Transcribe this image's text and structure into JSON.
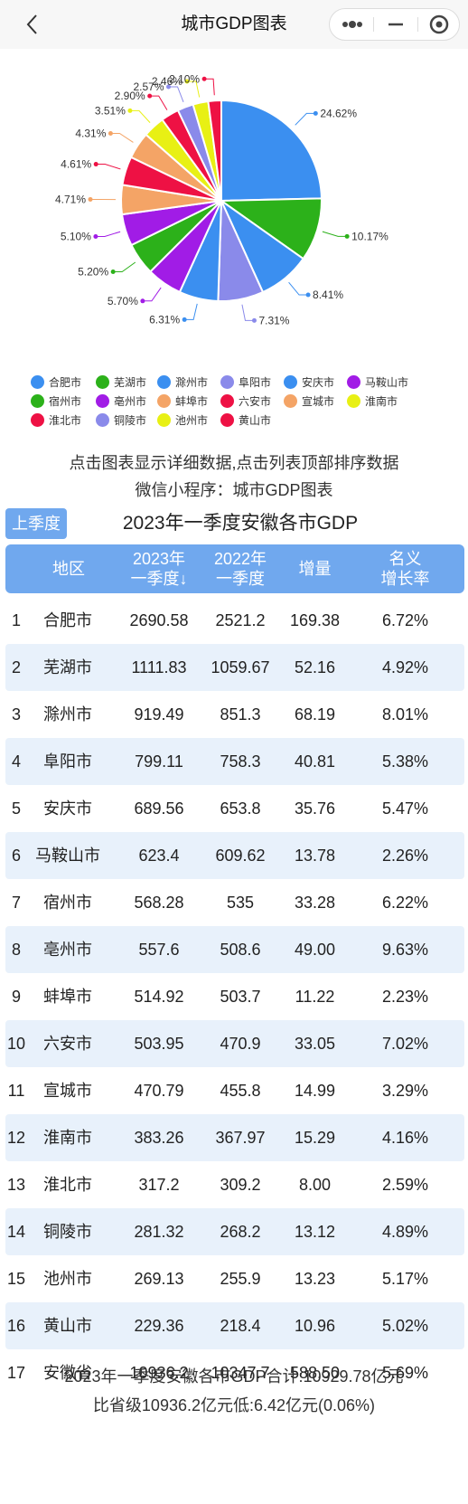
{
  "nav": {
    "title": "城市GDP图表",
    "back_icon": "chevron-left-icon",
    "more_icon": "more-dots-icon",
    "minimize_icon": "minimize-icon",
    "close_icon": "target-circle-icon"
  },
  "chart_data": {
    "type": "pie",
    "slices": [
      {
        "name": "合肥市",
        "value": 24.62,
        "label": "24.62%",
        "color": "#3b8ff0"
      },
      {
        "name": "芜湖市",
        "value": 10.17,
        "label": "10.17%",
        "color": "#2cb11a"
      },
      {
        "name": "滁州市",
        "value": 8.41,
        "label": "8.41%",
        "color": "#3b8ff0"
      },
      {
        "name": "阜阳市",
        "value": 7.31,
        "label": "7.31%",
        "color": "#8a8aea"
      },
      {
        "name": "安庆市",
        "value": 6.31,
        "label": "6.31%",
        "color": "#3b8ff0"
      },
      {
        "name": "马鞍山市",
        "value": 5.7,
        "label": "5.70%",
        "color": "#a11ce6"
      },
      {
        "name": "宿州市",
        "value": 5.2,
        "label": "5.20%",
        "color": "#2cb11a"
      },
      {
        "name": "亳州市",
        "value": 5.1,
        "label": "5.10%",
        "color": "#a11ce6"
      },
      {
        "name": "蚌埠市",
        "value": 4.71,
        "label": "4.71%",
        "color": "#f4a466"
      },
      {
        "name": "六安市",
        "value": 4.61,
        "label": "4.61%",
        "color": "#ee1144"
      },
      {
        "name": "宣城市",
        "value": 4.31,
        "label": "4.31%",
        "color": "#f4a466"
      },
      {
        "name": "淮南市",
        "value": 3.51,
        "label": "3.51%",
        "color": "#e8f014"
      },
      {
        "name": "淮北市",
        "value": 2.9,
        "label": "2.90%",
        "color": "#ee1144"
      },
      {
        "name": "铜陵市",
        "value": 2.57,
        "label": "2.57%",
        "color": "#8a8aea"
      },
      {
        "name": "池州市",
        "value": 2.46,
        "label": "2.46%",
        "color": "#e8f014"
      },
      {
        "name": "黄山市",
        "value": 2.1,
        "label": "2.10%",
        "color": "#ee1144"
      }
    ]
  },
  "hint_line1": "点击图表显示详细数据,点击列表顶部排序数据",
  "hint_line2": "微信小程序：城市GDP图表",
  "season_button": "上季度",
  "table_title": "2023年一季度安徽各市GDP",
  "headers": {
    "region": "地区",
    "y2023": "2023年\n一季度↓",
    "y2022": "2022年\n一季度",
    "increase": "增量",
    "growth": "名义\n增长率"
  },
  "rows": [
    {
      "rank": "1",
      "region": "合肥市",
      "y2023": "2690.58",
      "y2022": "2521.2",
      "increase": "169.38",
      "growth": "6.72%"
    },
    {
      "rank": "2",
      "region": "芜湖市",
      "y2023": "1111.83",
      "y2022": "1059.67",
      "increase": "52.16",
      "growth": "4.92%"
    },
    {
      "rank": "3",
      "region": "滁州市",
      "y2023": "919.49",
      "y2022": "851.3",
      "increase": "68.19",
      "growth": "8.01%"
    },
    {
      "rank": "4",
      "region": "阜阳市",
      "y2023": "799.11",
      "y2022": "758.3",
      "increase": "40.81",
      "growth": "5.38%"
    },
    {
      "rank": "5",
      "region": "安庆市",
      "y2023": "689.56",
      "y2022": "653.8",
      "increase": "35.76",
      "growth": "5.47%"
    },
    {
      "rank": "6",
      "region": "马鞍山市",
      "y2023": "623.4",
      "y2022": "609.62",
      "increase": "13.78",
      "growth": "2.26%"
    },
    {
      "rank": "7",
      "region": "宿州市",
      "y2023": "568.28",
      "y2022": "535",
      "increase": "33.28",
      "growth": "6.22%"
    },
    {
      "rank": "8",
      "region": "亳州市",
      "y2023": "557.6",
      "y2022": "508.6",
      "increase": "49.00",
      "growth": "9.63%"
    },
    {
      "rank": "9",
      "region": "蚌埠市",
      "y2023": "514.92",
      "y2022": "503.7",
      "increase": "11.22",
      "growth": "2.23%"
    },
    {
      "rank": "10",
      "region": "六安市",
      "y2023": "503.95",
      "y2022": "470.9",
      "increase": "33.05",
      "growth": "7.02%"
    },
    {
      "rank": "11",
      "region": "宣城市",
      "y2023": "470.79",
      "y2022": "455.8",
      "increase": "14.99",
      "growth": "3.29%"
    },
    {
      "rank": "12",
      "region": "淮南市",
      "y2023": "383.26",
      "y2022": "367.97",
      "increase": "15.29",
      "growth": "4.16%"
    },
    {
      "rank": "13",
      "region": "淮北市",
      "y2023": "317.2",
      "y2022": "309.2",
      "increase": "8.00",
      "growth": "2.59%"
    },
    {
      "rank": "14",
      "region": "铜陵市",
      "y2023": "281.32",
      "y2022": "268.2",
      "increase": "13.12",
      "growth": "4.89%"
    },
    {
      "rank": "15",
      "region": "池州市",
      "y2023": "269.13",
      "y2022": "255.9",
      "increase": "13.23",
      "growth": "5.17%"
    },
    {
      "rank": "16",
      "region": "黄山市",
      "y2023": "229.36",
      "y2022": "218.4",
      "increase": "10.96",
      "growth": "5.02%"
    },
    {
      "rank": "17",
      "region": "安徽省",
      "y2023": "10936.2",
      "y2022": "10347.7",
      "increase": "588.50",
      "growth": "5.69%"
    }
  ],
  "footer_line1": "2023年一季度安徽各市GDP合计:10929.78亿元",
  "footer_line2": "比省级10936.2亿元低:6.42亿元(0.06%)"
}
